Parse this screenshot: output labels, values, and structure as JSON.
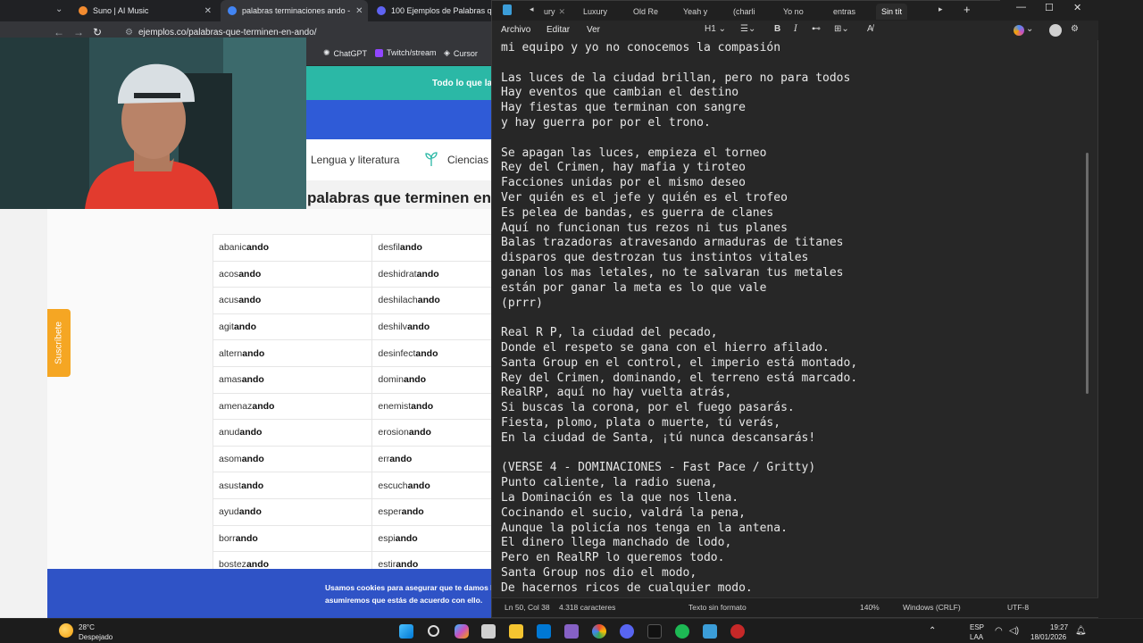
{
  "browser": {
    "tabs": [
      {
        "label": "Suno | AI Music",
        "color": "#f28b30"
      },
      {
        "label": "palabras terminaciones ando -",
        "color": "#4285f4"
      },
      {
        "label": "100 Ejemplos de Palabras que",
        "color": "#5f63f2"
      }
    ],
    "url": "ejemplos.co/palabras-que-terminen-en-ando/",
    "bookmarks": [
      "ChatGPT",
      "Twitch/stream",
      "Cursor"
    ],
    "page": {
      "banner_text": "Todo lo que la",
      "nav": [
        "Lengua y literatura",
        "Ciencias"
      ],
      "heading": "palabras que terminen en",
      "subscribe": "Suscríbete",
      "cookie_line1": "Usamos cookies para asegurar que te damos l",
      "cookie_line2": "asumiremos que estás de acuerdo con ello.",
      "words_left": [
        [
          "abanic",
          "ando"
        ],
        [
          "acos",
          "ando"
        ],
        [
          "acus",
          "ando"
        ],
        [
          "agit",
          "ando"
        ],
        [
          "altern",
          "ando"
        ],
        [
          "amas",
          "ando"
        ],
        [
          "amenaz",
          "ando"
        ],
        [
          "anud",
          "ando"
        ],
        [
          "asom",
          "ando"
        ],
        [
          "asust",
          "ando"
        ],
        [
          "ayud",
          "ando"
        ],
        [
          "borr",
          "ando"
        ],
        [
          "bostez",
          "ando"
        ]
      ],
      "words_right": [
        [
          "desfil",
          "ando"
        ],
        [
          "deshidrat",
          "ando"
        ],
        [
          "deshilach",
          "ando"
        ],
        [
          "deshilv",
          "ando"
        ],
        [
          "desinfect",
          "ando"
        ],
        [
          "domin",
          "ando"
        ],
        [
          "enemist",
          "ando"
        ],
        [
          "erosion",
          "ando"
        ],
        [
          "err",
          "ando"
        ],
        [
          "escuch",
          "ando"
        ],
        [
          "esper",
          "ando"
        ],
        [
          "espi",
          "ando"
        ],
        [
          "estir",
          "ando"
        ]
      ]
    }
  },
  "notepad": {
    "tabs": [
      "ury",
      "Luxury",
      "Old Re",
      "Yeah y",
      "(charli",
      "Yo no",
      "entras",
      "Sin tít"
    ],
    "menu": [
      "Archivo",
      "Editar",
      "Ver"
    ],
    "heading_selector": "H1",
    "lines": [
      "mi equipo y yo no conocemos la compasión",
      "",
      "Las luces de la ciudad brillan, pero no para todos",
      "Hay eventos que cambian el destino",
      "Hay fiestas que terminan con sangre",
      "y hay guerra por por el trono.",
      "",
      "Se apagan las luces, empieza el torneo",
      "Rey del Crimen, hay mafia y tiroteo",
      "Facciones unidas por el mismo deseo",
      "Ver quién es el jefe y quién es el trofeo",
      "Es pelea de bandas, es guerra de clanes",
      "Aquí no funcionan tus rezos ni tus planes",
      "Balas trazadoras atravesando armaduras de titanes",
      "disparos que destrozan tus instintos vitales",
      "ganan los mas letales, no te salvaran tus metales",
      "están por ganar la meta es lo que vale",
      "(prrr)",
      "",
      "Real R P, la ciudad del pecado,",
      "Donde el respeto se gana con el hierro afilado.",
      "Santa Group en el control, el imperio está montado,",
      "Rey del Crimen, dominando, el terreno está marcado.",
      "RealRP, aquí no hay vuelta atrás,",
      "Si buscas la corona, por el fuego pasarás.",
      "Fiesta, plomo, plata o muerte, tú verás,",
      "En la ciudad de Santa, ¡tú nunca descansarás!",
      "",
      "(VERSE 4 - DOMINACIONES - Fast Pace / Gritty)",
      "Punto caliente, la radio suena,",
      "La Dominación es la que nos llena.",
      "Cocinando el sucio, valdrá la pena,",
      "Aunque la policía nos tenga en la antena.",
      "El dinero llega manchado de lodo,",
      "Pero en RealRP lo queremos todo.",
      "Santa Group nos dio el modo,",
      "De hacernos ricos de cualquier modo."
    ],
    "status": {
      "position": "Ln 50, Col 38",
      "chars": "4.318 caracteres",
      "format": "Texto sin formato",
      "zoom": "140%",
      "eol": "Windows (CRLF)",
      "encoding": "UTF-8"
    }
  },
  "taskbar": {
    "weather_temp": "28°C",
    "weather_desc": "Despejado",
    "lang1": "ESP",
    "lang2": "LAA",
    "time": "19:27",
    "date": "18/01/2026"
  }
}
